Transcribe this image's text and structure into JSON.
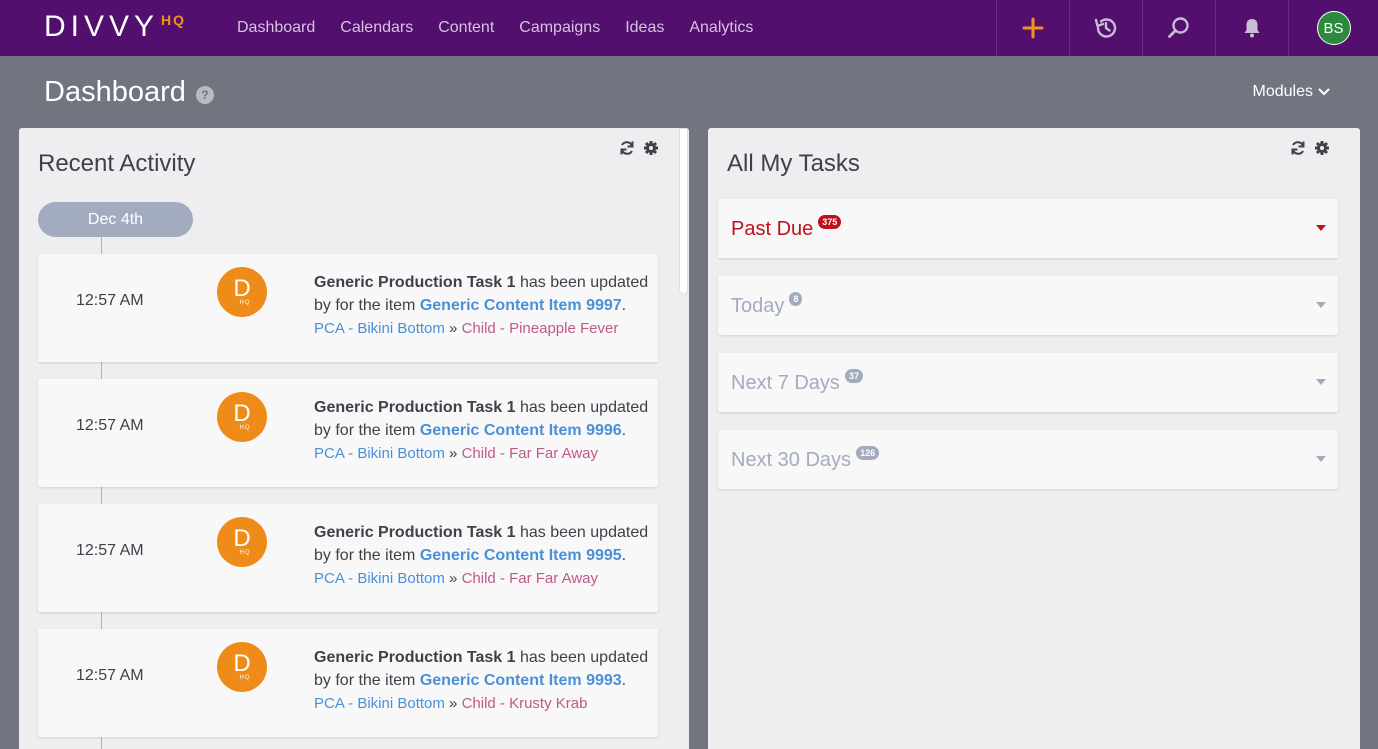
{
  "app": {
    "logo_main": "DIVVY",
    "logo_sub": "HQ"
  },
  "nav": {
    "items": [
      "Dashboard",
      "Calendars",
      "Content",
      "Campaigns",
      "Ideas",
      "Analytics"
    ],
    "avatar_initials": "BS"
  },
  "header": {
    "title": "Dashboard",
    "help": "?",
    "modules_label": "Modules"
  },
  "recent_activity": {
    "title": "Recent Activity",
    "date_label": "Dec 4th",
    "items": [
      {
        "time": "12:57 AM",
        "task": "Generic Production Task 1",
        "middle": " has been updated by for the item ",
        "item": "Generic Content Item 9997",
        "end": ".",
        "campaign": "PCA - Bikini Bottom",
        "sep": " » ",
        "child": "Child - Pineapple Fever"
      },
      {
        "time": "12:57 AM",
        "task": "Generic Production Task 1",
        "middle": " has been updated by for the item ",
        "item": "Generic Content Item 9996",
        "end": ".",
        "campaign": "PCA - Bikini Bottom",
        "sep": " » ",
        "child": "Child - Far Far Away"
      },
      {
        "time": "12:57 AM",
        "task": "Generic Production Task 1",
        "middle": " has been updated by for the item ",
        "item": "Generic Content Item 9995",
        "end": ".",
        "campaign": "PCA - Bikini Bottom",
        "sep": " » ",
        "child": "Child - Far Far Away"
      },
      {
        "time": "12:57 AM",
        "task": "Generic Production Task 1",
        "middle": " has been updated by for the item ",
        "item": "Generic Content Item 9993",
        "end": ".",
        "campaign": "PCA - Bikini Bottom",
        "sep": " » ",
        "child": "Child - Krusty Krab"
      }
    ],
    "logo_letter": "D",
    "logo_sub": "HQ"
  },
  "tasks": {
    "title": "All My Tasks",
    "groups": [
      {
        "label": "Past Due",
        "count": "375",
        "color": "#c0101c"
      },
      {
        "label": "Today",
        "count": "8",
        "color": "#a2acbe"
      },
      {
        "label": "Next 7 Days",
        "count": "37",
        "color": "#a2acbe"
      },
      {
        "label": "Next 30 Days",
        "count": "126",
        "color": "#a2acbe"
      }
    ]
  },
  "colors": {
    "topbar": "#530f6e",
    "accent_orange": "#f0931b",
    "past_due_red": "#c0101c"
  }
}
